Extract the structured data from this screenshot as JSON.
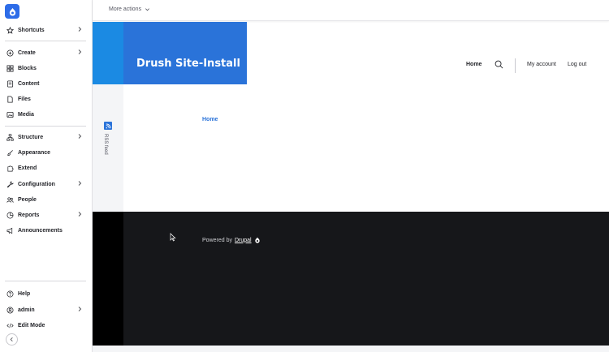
{
  "sidebar": {
    "items": [
      {
        "label": "Shortcuts",
        "icon": "star-icon",
        "has_children": true
      },
      {
        "label": "Create",
        "icon": "plus-icon",
        "has_children": true
      },
      {
        "label": "Blocks",
        "icon": "blocks-icon",
        "has_children": false
      },
      {
        "label": "Content",
        "icon": "content-icon",
        "has_children": false
      },
      {
        "label": "Files",
        "icon": "file-icon",
        "has_children": false
      },
      {
        "label": "Media",
        "icon": "media-icon",
        "has_children": false
      },
      {
        "label": "Structure",
        "icon": "structure-icon",
        "has_children": true
      },
      {
        "label": "Appearance",
        "icon": "brush-icon",
        "has_children": false
      },
      {
        "label": "Extend",
        "icon": "puzzle-icon",
        "has_children": false
      },
      {
        "label": "Configuration",
        "icon": "wrench-icon",
        "has_children": true
      },
      {
        "label": "People",
        "icon": "people-icon",
        "has_children": false
      },
      {
        "label": "Reports",
        "icon": "reports-icon",
        "has_children": true
      },
      {
        "label": "Announcements",
        "icon": "megaphone-icon",
        "has_children": false
      }
    ],
    "bottom": {
      "help": "Help",
      "user": "admin",
      "edit_mode": "Edit Mode"
    }
  },
  "topbar": {
    "more_actions": "More actions"
  },
  "site": {
    "title": "Drush Site-Install",
    "nav_home": "Home",
    "my_account": "My account",
    "log_out": "Log out",
    "rss_label": "RSS feed",
    "breadcrumb_home": "Home",
    "powered_by": "Powered by",
    "drupal_link": "Drupal"
  },
  "colors": {
    "accent": "#2a73d9",
    "footer": "#16171a"
  }
}
